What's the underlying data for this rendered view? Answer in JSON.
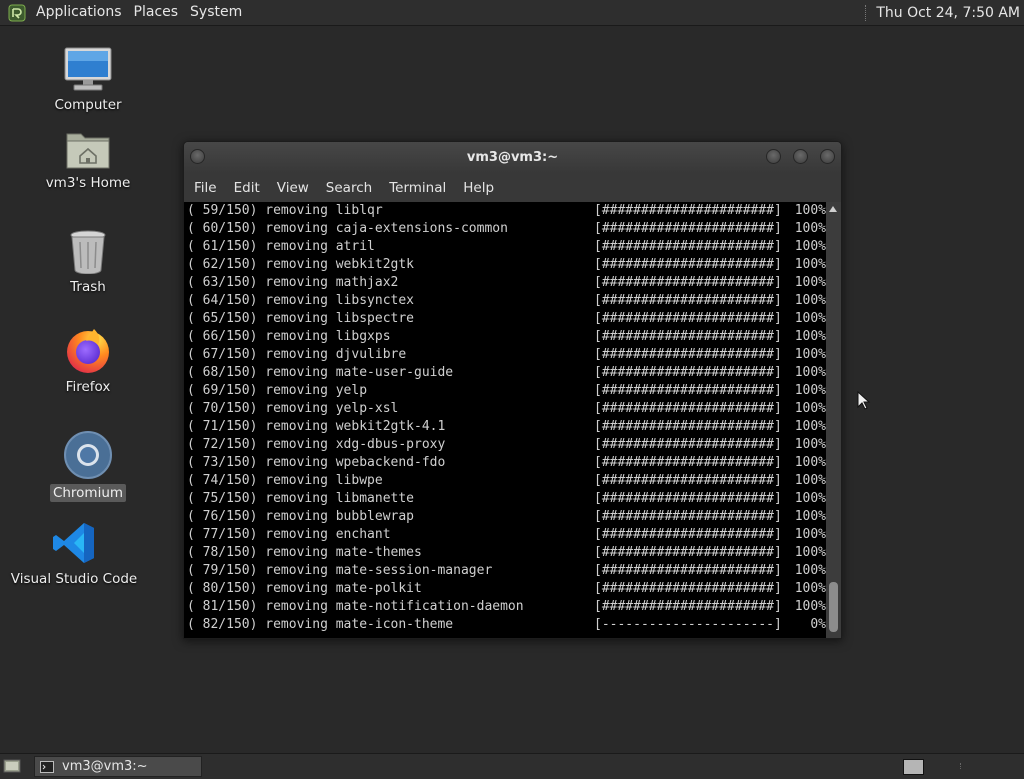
{
  "top_panel": {
    "menu_icon": "mate-menu-icon",
    "menus": [
      "Applications",
      "Places",
      "System"
    ],
    "clock": "Thu Oct 24,  7:50 AM"
  },
  "desktop_icons": [
    {
      "label": "Computer",
      "icon": "computer-icon"
    },
    {
      "label": "vm3's Home",
      "icon": "home-folder-icon"
    },
    {
      "label": "Trash",
      "icon": "trash-icon"
    },
    {
      "label": "Firefox",
      "icon": "firefox-icon"
    },
    {
      "label": "Chromium",
      "icon": "chromium-icon",
      "selected": true
    },
    {
      "label": "Visual Studio Code",
      "icon": "vscode-icon"
    }
  ],
  "terminal": {
    "title": "vm3@vm3:~",
    "menus": [
      "File",
      "Edit",
      "View",
      "Search",
      "Terminal",
      "Help"
    ],
    "lines": [
      {
        "num": "( 59/150)",
        "action": "removing",
        "pkg": "liblqr",
        "bar": "[######################]",
        "pct": "100%"
      },
      {
        "num": "( 60/150)",
        "action": "removing",
        "pkg": "caja-extensions-common",
        "bar": "[######################]",
        "pct": "100%"
      },
      {
        "num": "( 61/150)",
        "action": "removing",
        "pkg": "atril",
        "bar": "[######################]",
        "pct": "100%"
      },
      {
        "num": "( 62/150)",
        "action": "removing",
        "pkg": "webkit2gtk",
        "bar": "[######################]",
        "pct": "100%"
      },
      {
        "num": "( 63/150)",
        "action": "removing",
        "pkg": "mathjax2",
        "bar": "[######################]",
        "pct": "100%"
      },
      {
        "num": "( 64/150)",
        "action": "removing",
        "pkg": "libsynctex",
        "bar": "[######################]",
        "pct": "100%"
      },
      {
        "num": "( 65/150)",
        "action": "removing",
        "pkg": "libspectre",
        "bar": "[######################]",
        "pct": "100%"
      },
      {
        "num": "( 66/150)",
        "action": "removing",
        "pkg": "libgxps",
        "bar": "[######################]",
        "pct": "100%"
      },
      {
        "num": "( 67/150)",
        "action": "removing",
        "pkg": "djvulibre",
        "bar": "[######################]",
        "pct": "100%"
      },
      {
        "num": "( 68/150)",
        "action": "removing",
        "pkg": "mate-user-guide",
        "bar": "[######################]",
        "pct": "100%"
      },
      {
        "num": "( 69/150)",
        "action": "removing",
        "pkg": "yelp",
        "bar": "[######################]",
        "pct": "100%"
      },
      {
        "num": "( 70/150)",
        "action": "removing",
        "pkg": "yelp-xsl",
        "bar": "[######################]",
        "pct": "100%"
      },
      {
        "num": "( 71/150)",
        "action": "removing",
        "pkg": "webkit2gtk-4.1",
        "bar": "[######################]",
        "pct": "100%"
      },
      {
        "num": "( 72/150)",
        "action": "removing",
        "pkg": "xdg-dbus-proxy",
        "bar": "[######################]",
        "pct": "100%"
      },
      {
        "num": "( 73/150)",
        "action": "removing",
        "pkg": "wpebackend-fdo",
        "bar": "[######################]",
        "pct": "100%"
      },
      {
        "num": "( 74/150)",
        "action": "removing",
        "pkg": "libwpe",
        "bar": "[######################]",
        "pct": "100%"
      },
      {
        "num": "( 75/150)",
        "action": "removing",
        "pkg": "libmanette",
        "bar": "[######################]",
        "pct": "100%"
      },
      {
        "num": "( 76/150)",
        "action": "removing",
        "pkg": "bubblewrap",
        "bar": "[######################]",
        "pct": "100%"
      },
      {
        "num": "( 77/150)",
        "action": "removing",
        "pkg": "enchant",
        "bar": "[######################]",
        "pct": "100%"
      },
      {
        "num": "( 78/150)",
        "action": "removing",
        "pkg": "mate-themes",
        "bar": "[######################]",
        "pct": "100%"
      },
      {
        "num": "( 79/150)",
        "action": "removing",
        "pkg": "mate-session-manager",
        "bar": "[######################]",
        "pct": "100%"
      },
      {
        "num": "( 80/150)",
        "action": "removing",
        "pkg": "mate-polkit",
        "bar": "[######################]",
        "pct": "100%"
      },
      {
        "num": "( 81/150)",
        "action": "removing",
        "pkg": "mate-notification-daemon",
        "bar": "[######################]",
        "pct": "100%"
      },
      {
        "num": "( 82/150)",
        "action": "removing",
        "pkg": "mate-icon-theme",
        "bar": "[----------------------]",
        "pct": "0%"
      }
    ]
  },
  "bottom_panel": {
    "show_desktop_icon": "show-desktop-icon",
    "task": {
      "label": "vm3@vm3:~",
      "icon": "terminal-icon"
    }
  },
  "colors": {
    "desktop_bg": "#292929",
    "panel_bg": "#2e2e2e",
    "terminal_bg": "#000000",
    "terminal_fg": "#d0d0d0"
  }
}
